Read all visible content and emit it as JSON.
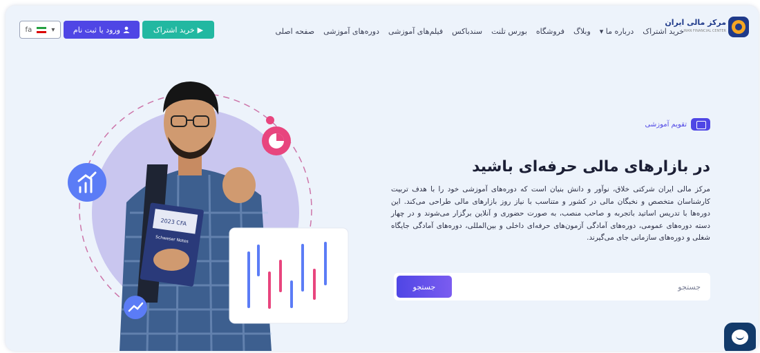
{
  "brand": {
    "name": "مرکز مالی ایران",
    "tagline": "IRAN FINANCIAL CENTER"
  },
  "nav": {
    "items": [
      {
        "label": "صفحه اصلی"
      },
      {
        "label": "دوره‌های آموزشی"
      },
      {
        "label": "فیلم‌های آموزشی"
      },
      {
        "label": "سندباکس"
      },
      {
        "label": "بورس تلنت"
      },
      {
        "label": "فروشگاه"
      },
      {
        "label": "وبلاگ"
      },
      {
        "label": "درباره ما ▾"
      },
      {
        "label": "خرید اشتراک"
      }
    ]
  },
  "header": {
    "buy_label": "خرید اشتراک",
    "login_label": "ورود یا ثبت نام",
    "lang_code": "fa",
    "lang_caret": "▾"
  },
  "hero": {
    "badge_label": "تقویم آموزشی",
    "title": "در بازارهای مالی حرفه‌ای باشید",
    "description": "مرکز مالی ایران شرکتی خلاق، نوآور و دانش بنیان است که دوره‌های آموزشی خود را با هدف تربیت کارشناسان متخصص و نخبگان مالی در کشور و متناسب با نیاز روز بازارهای مالی طراحی می‌کند. این دوره‌ها با تدریس اساتید باتجربه و صاحب منصب، به صورت حضوری و آنلاین برگزار می‌شوند و در چهار دسته دوره‌های عمومی، دوره‌های آمادگی آزمون‌های حرفه‌ای داخلی و بین‌المللی، دوره‌های آمادگی جایگاه شغلی و دوره‌های سازمانی جای می‌گیرند."
  },
  "search": {
    "placeholder": "جستجو",
    "button_label": "جستجو"
  },
  "illustration": {
    "book_title": "2023 CFA",
    "book_subtitle": "Schweser Notes"
  },
  "colors": {
    "primary": "#4f46e5",
    "teal": "#22b8a1",
    "pink": "#e8457e",
    "blue": "#5b7cf6",
    "background": "#edf3fb"
  }
}
